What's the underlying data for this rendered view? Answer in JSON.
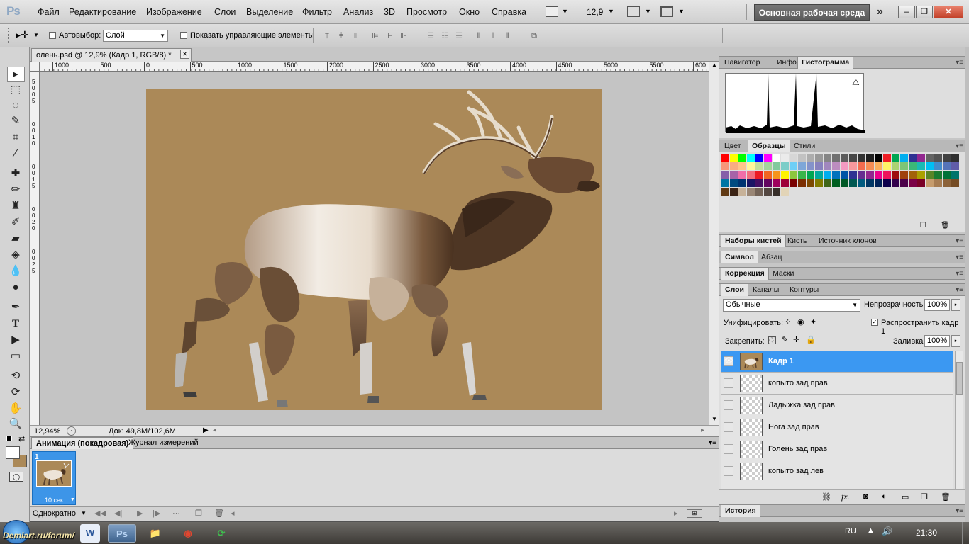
{
  "app": {
    "logo": "Ps"
  },
  "menu": [
    "Файл",
    "Редактирование",
    "Изображение",
    "Слои",
    "Выделение",
    "Фильтр",
    "Анализ",
    "3D",
    "Просмотр",
    "Окно",
    "Справка"
  ],
  "menubar_extra": {
    "zoom": "12,9",
    "workspace": "Основная рабочая среда",
    "overflow": "»"
  },
  "window_buttons": {
    "minimize": "–",
    "restore": "❐",
    "close": "✕"
  },
  "options": {
    "autoselect_label": "Автовыбор:",
    "autoselect_value": "Слой",
    "show_controls_label": "Показать управляющие элементы"
  },
  "document": {
    "tab_title": "олень.psd @ 12,9% (Кадр 1, RGB/8) *",
    "ruler_top": [
      "1000",
      "500",
      "0",
      "500",
      "1000",
      "1500",
      "2000",
      "2500",
      "3000",
      "3500",
      "4000",
      "4500",
      "5000",
      "5500",
      "600"
    ],
    "ruler_left": [
      "5",
      "0",
      "0",
      "5",
      "0",
      "0",
      "1",
      "0",
      "0",
      "0",
      "1",
      "5",
      "0",
      "0",
      "2",
      "0",
      "0",
      "0",
      "2",
      "5"
    ]
  },
  "status": {
    "zoom": "12,94%",
    "doc_info": "Док: 49,8M/102,6M"
  },
  "animation": {
    "tabs": [
      "Анимация (покадровая)",
      "Журнал измерений"
    ],
    "frame_number": "1",
    "frame_delay": "10 сек.",
    "loop": "Однократно"
  },
  "panels": {
    "histogram_tabs": [
      "Навигатор",
      "Инфо",
      "Гистограмма"
    ],
    "swatch_tabs": [
      "Цвет",
      "Образцы",
      "Стили"
    ],
    "brush_tabs": [
      "Наборы кистей",
      "Кисть",
      "Источник клонов"
    ],
    "char_tabs": [
      "Символ",
      "Абзац"
    ],
    "adjust_tabs": [
      "Коррекция",
      "Маски"
    ],
    "layer_tabs": [
      "Слои",
      "Каналы",
      "Контуры"
    ],
    "history_tab": "История"
  },
  "layers_panel": {
    "blend_mode": "Обычные",
    "opacity_label": "Непрозрачность:",
    "opacity_value": "100%",
    "unify_label": "Унифицировать:",
    "propagate_label": "Распространить кадр 1",
    "lock_label": "Закрепить:",
    "fill_label": "Заливка:",
    "fill_value": "100%",
    "layers": [
      {
        "name": "Кадр 1",
        "selected": true
      },
      {
        "name": "копыто зад прав",
        "selected": false
      },
      {
        "name": "Ладыжка зад прав",
        "selected": false
      },
      {
        "name": "Нога зад прав",
        "selected": false
      },
      {
        "name": "Голень зад прав",
        "selected": false
      },
      {
        "name": "копыто зад лев",
        "selected": false
      }
    ]
  },
  "swatches": [
    "#ff0000",
    "#ffff00",
    "#00ff00",
    "#00ffff",
    "#0000ff",
    "#ff00ff",
    "#ffffff",
    "#ebebeb",
    "#d6d6d6",
    "#c2c2c2",
    "#adadad",
    "#999999",
    "#858585",
    "#707070",
    "#5c5c5c",
    "#474747",
    "#333333",
    "#1f1f1f",
    "#000000",
    "#ee1d24",
    "#00a651",
    "#00aeef",
    "#2e3192",
    "#92278f",
    "#636363",
    "#525252",
    "#404040",
    "#2e2e2e",
    "#f7977a",
    "#f9ad81",
    "#fdc68a",
    "#fff79a",
    "#c4df9b",
    "#a3d39c",
    "#82ca9d",
    "#7bcdc8",
    "#6ecff6",
    "#7ea7d8",
    "#8493ca",
    "#8882be",
    "#a187be",
    "#bc8dbf",
    "#f49ac2",
    "#f6989d",
    "#f26c4f",
    "#f68e55",
    "#fbaf5c",
    "#fff467",
    "#acd372",
    "#7cc576",
    "#3bb878",
    "#1abbb4",
    "#00bff3",
    "#438ccb",
    "#5574b9",
    "#605ca8",
    "#855fa8",
    "#a763a8",
    "#f06ea9",
    "#f26d7d",
    "#ed1c24",
    "#f26522",
    "#f7941d",
    "#fff200",
    "#8dc63f",
    "#39b54a",
    "#00a651",
    "#00a99d",
    "#00aeef",
    "#0072bc",
    "#0054a6",
    "#2e3192",
    "#662d91",
    "#92278f",
    "#ec008c",
    "#ed145b",
    "#9e0b0f",
    "#a0410d",
    "#a36209",
    "#aba000",
    "#598527",
    "#1a7b30",
    "#007236",
    "#00746b",
    "#0076a3",
    "#004b80",
    "#003471",
    "#1b1464",
    "#440e62",
    "#630460",
    "#9e005d",
    "#9e0039",
    "#790000",
    "#7b2e00",
    "#7d4900",
    "#827b00",
    "#406618",
    "#005e20",
    "#005826",
    "#005952",
    "#005b7f",
    "#003663",
    "#002157",
    "#0d004c",
    "#32004b",
    "#4b0049",
    "#7b0046",
    "#7a0026",
    "#c69c6d",
    "#a67c52",
    "#8c6239",
    "#754c24",
    "#603913",
    "#3c2415",
    "#c7b299",
    "#998675",
    "#736357",
    "#534741",
    "#372f2a",
    "#e2d4b7"
  ],
  "taskbar": {
    "site": "Demiart.ru/forum/",
    "lang": "RU",
    "time": "21:30",
    "apps": [
      "W",
      "Ps",
      "📁",
      "◉",
      "⟳"
    ]
  }
}
